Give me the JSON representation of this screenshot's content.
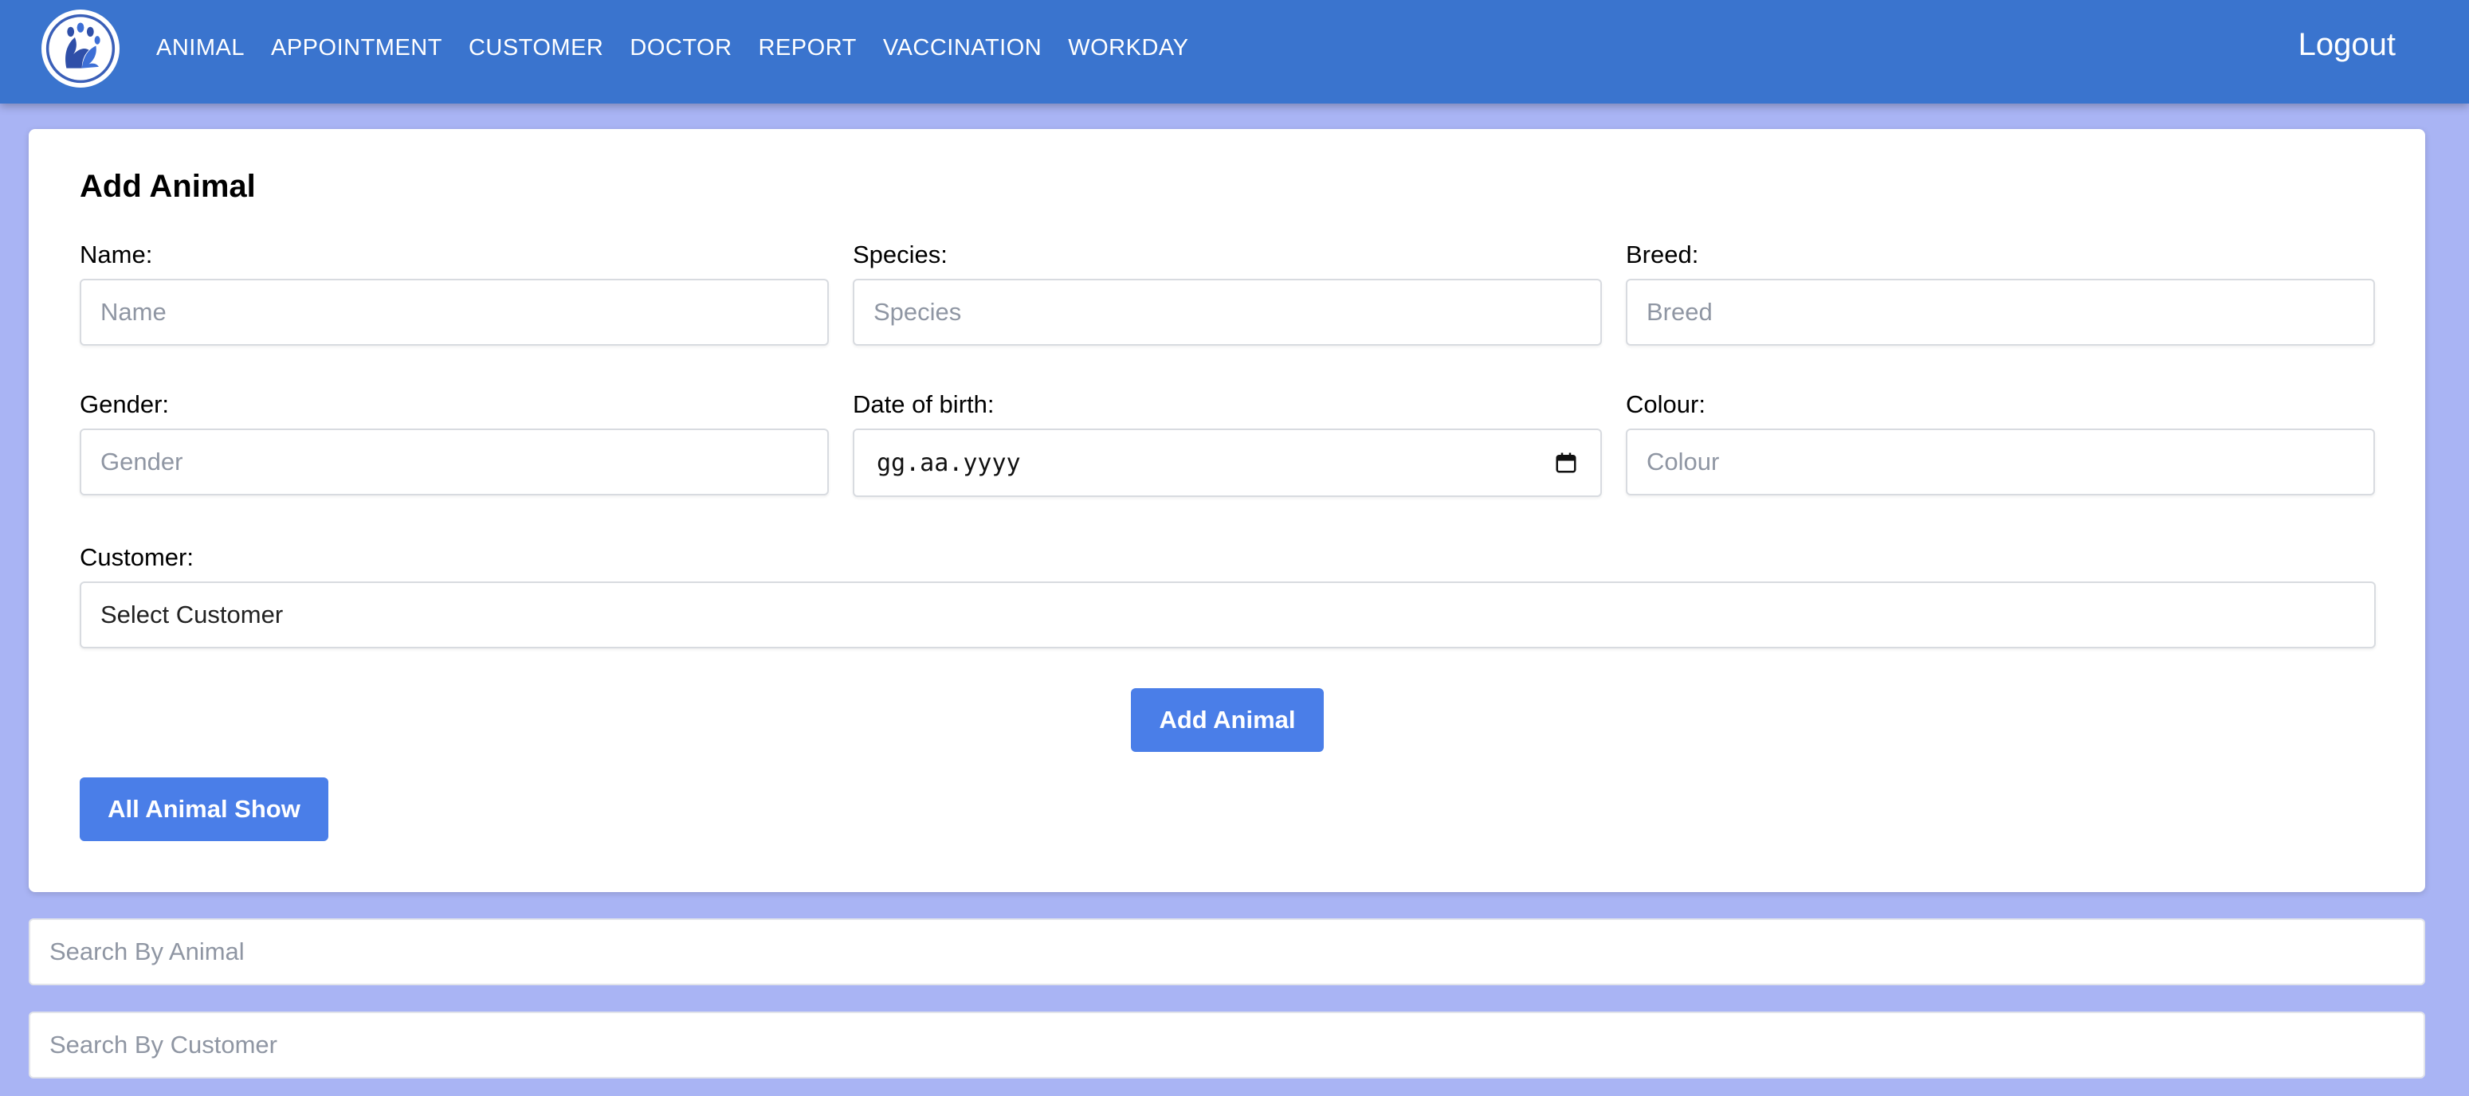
{
  "navbar": {
    "logo_name": "paw-logo",
    "links": [
      "ANIMAL",
      "APPOINTMENT",
      "CUSTOMER",
      "DOCTOR",
      "REPORT",
      "VACCINATION",
      "WORKDAY"
    ],
    "logout_label": "Logout",
    "colors": {
      "bar": "#3a74ce",
      "text": "#ffffff"
    }
  },
  "form": {
    "title": "Add Animal",
    "fields": {
      "name": {
        "label": "Name:",
        "placeholder": "Name"
      },
      "species": {
        "label": "Species:",
        "placeholder": "Species"
      },
      "breed": {
        "label": "Breed:",
        "placeholder": "Breed"
      },
      "gender": {
        "label": "Gender:",
        "placeholder": "Gender"
      },
      "dob": {
        "label": "Date of birth:",
        "value": "gg.aa.yyyy"
      },
      "colour": {
        "label": "Colour:",
        "placeholder": "Colour"
      },
      "customer": {
        "label": "Customer:",
        "selected": "Select Customer"
      }
    },
    "add_button": "Add Animal",
    "show_all_button": "All Animal Show"
  },
  "search": {
    "animal_placeholder": "Search By Animal",
    "customer_placeholder": "Search By Customer"
  },
  "colors": {
    "page_bg": "#a9b4f4",
    "button": "#4a7ee8"
  }
}
